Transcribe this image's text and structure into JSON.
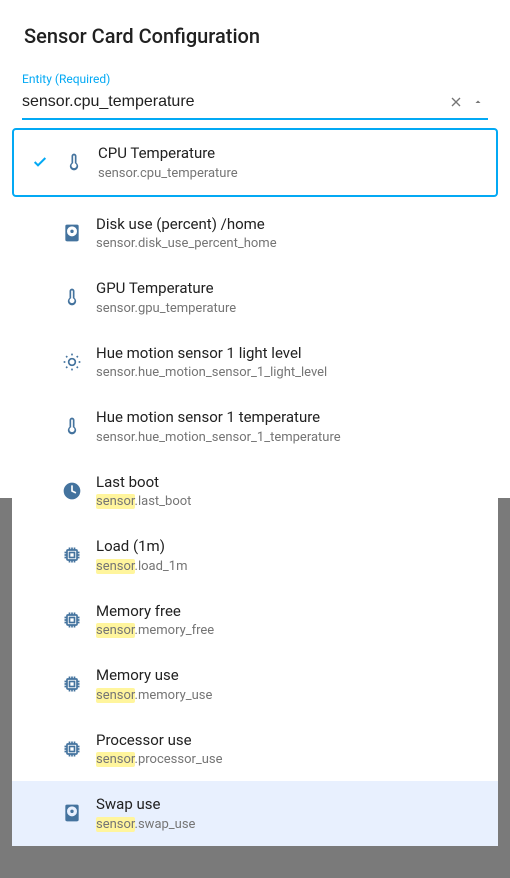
{
  "dialog": {
    "title": "Sensor Card Configuration"
  },
  "field": {
    "label": "Entity (Required)",
    "value": "sensor.cpu_temperature"
  },
  "options": [
    {
      "icon": "thermometer",
      "title": "CPU Temperature",
      "sub": "sensor.cpu_temperature",
      "selected": true,
      "highlight": false
    },
    {
      "icon": "harddisk",
      "title": "Disk use (percent) /home",
      "sub": "sensor.disk_use_percent_home",
      "selected": false,
      "highlight": false
    },
    {
      "icon": "thermometer",
      "title": "GPU Temperature",
      "sub": "sensor.gpu_temperature",
      "selected": false,
      "highlight": false
    },
    {
      "icon": "brightness",
      "title": "Hue motion sensor 1 light level",
      "sub": "sensor.hue_motion_sensor_1_light_level",
      "selected": false,
      "highlight": false
    },
    {
      "icon": "thermometer",
      "title": "Hue motion sensor 1 temperature",
      "sub": "sensor.hue_motion_sensor_1_temperature",
      "selected": false,
      "highlight": false
    },
    {
      "icon": "clock",
      "title": "Last boot",
      "sub": "sensor.last_boot",
      "selected": false,
      "highlight": true
    },
    {
      "icon": "chip",
      "title": "Load (1m)",
      "sub": "sensor.load_1m",
      "selected": false,
      "highlight": true
    },
    {
      "icon": "chip",
      "title": "Memory free",
      "sub": "sensor.memory_free",
      "selected": false,
      "highlight": true
    },
    {
      "icon": "chip",
      "title": "Memory use",
      "sub": "sensor.memory_use",
      "selected": false,
      "highlight": true
    },
    {
      "icon": "chip",
      "title": "Processor use",
      "sub": "sensor.processor_use",
      "selected": false,
      "highlight": true
    },
    {
      "icon": "harddisk",
      "title": "Swap use",
      "sub": "sensor.swap_use",
      "selected": false,
      "highlight": true,
      "rowHighlighted": true
    }
  ]
}
